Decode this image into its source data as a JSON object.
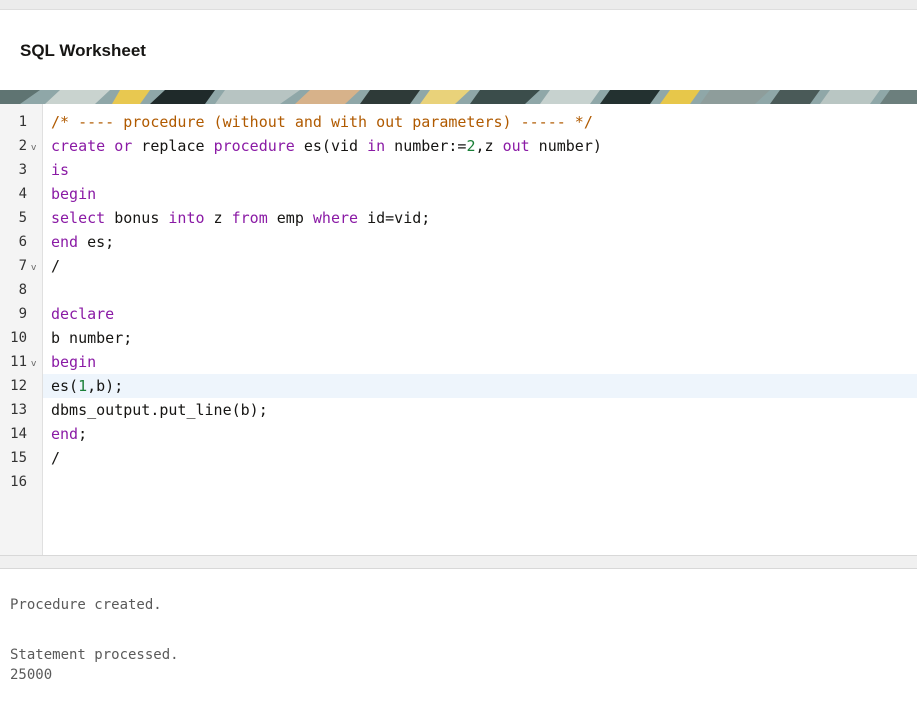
{
  "header": {
    "title": "SQL Worksheet"
  },
  "colors": {
    "keyword": "#8a1aa5",
    "comment": "#b05a00",
    "number": "#1a7f37",
    "active_line": "#eef5fc"
  },
  "editor": {
    "active_line": 12,
    "lines": [
      {
        "num": "1",
        "fold": "",
        "text": "/* ---- procedure (without and with out parameters) ----- */"
      },
      {
        "num": "2",
        "fold": "v",
        "p1": "create",
        "p2": " ",
        "p3": "or",
        "p4": " replace ",
        "p5": "procedure",
        "p6": " es(vid ",
        "p7": "in",
        "p8": " number:=",
        "p9": "2",
        "p10": ",z ",
        "p11": "out",
        "p12": " number)"
      },
      {
        "num": "3",
        "fold": "",
        "text": "is"
      },
      {
        "num": "4",
        "fold": "",
        "text": "begin"
      },
      {
        "num": "5",
        "fold": "",
        "p1": "select",
        "p2": " bonus ",
        "p3": "into",
        "p4": " z ",
        "p5": "from",
        "p6": " emp ",
        "p7": "where",
        "p8": " id=vid;"
      },
      {
        "num": "6",
        "fold": "",
        "p1": "end",
        "p2": " es;"
      },
      {
        "num": "7",
        "fold": "v",
        "text": "/"
      },
      {
        "num": "8",
        "fold": "",
        "text": ""
      },
      {
        "num": "9",
        "fold": "",
        "text": "declare"
      },
      {
        "num": "10",
        "fold": "",
        "text": "b number;"
      },
      {
        "num": "11",
        "fold": "v",
        "text": "begin"
      },
      {
        "num": "12",
        "fold": "",
        "p1": "es(",
        "p2": "1",
        "p3": ",b);"
      },
      {
        "num": "13",
        "fold": "",
        "text": "dbms_output.put_line(b);"
      },
      {
        "num": "14",
        "fold": "",
        "p1": "end",
        "p2": ";"
      },
      {
        "num": "15",
        "fold": "",
        "text": "/"
      },
      {
        "num": "16",
        "fold": "",
        "text": ""
      }
    ]
  },
  "output": {
    "lines": [
      "Procedure created.",
      "Statement processed.",
      "25000"
    ]
  }
}
